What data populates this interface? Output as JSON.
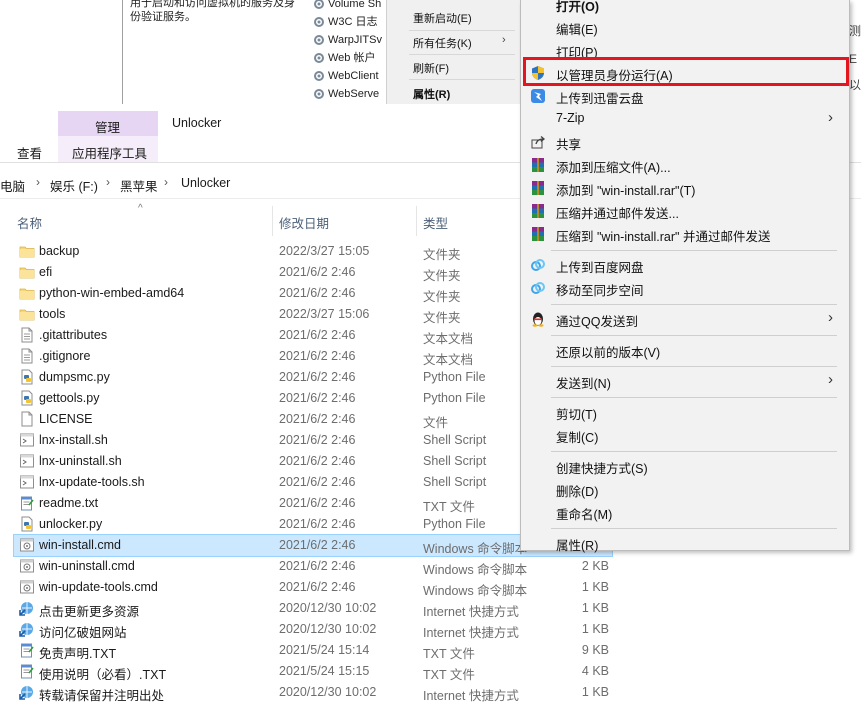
{
  "services": {
    "description": "用于启动和访问虚拟机的服务及身份验证服务。",
    "items": [
      "Volume Sh",
      "W3C 日志",
      "WarpJITSv",
      "Web 帐户",
      "WebClient",
      "WebServe"
    ],
    "menu": {
      "restart": "重新启动(E)",
      "all_tasks": "所有任务(K)",
      "all_tasks_arrow": "›",
      "refresh": "刷新(F)",
      "properties": "属性(R)"
    },
    "right_edge": [
      "测",
      "E",
      "以"
    ]
  },
  "ribbon": {
    "tab_manage": "管理",
    "window_title": "Unlocker",
    "tab_view": "查看",
    "tab_app_tools": "应用程序工具"
  },
  "address": {
    "crumbs": [
      "电脑",
      "娱乐 (F:)",
      "黑苹果",
      "Unlocker"
    ],
    "sep": "›"
  },
  "columns": {
    "name": "名称",
    "date": "修改日期",
    "type": "类型",
    "sort_caret": "^"
  },
  "files": [
    {
      "name": "backup",
      "date": "2022/3/27 15:05",
      "type": "文件夹",
      "size": "",
      "icon": "folder-icon"
    },
    {
      "name": "efi",
      "date": "2021/6/2 2:46",
      "type": "文件夹",
      "size": "",
      "icon": "folder-icon"
    },
    {
      "name": "python-win-embed-amd64",
      "date": "2021/6/2 2:46",
      "type": "文件夹",
      "size": "",
      "icon": "folder-icon"
    },
    {
      "name": "tools",
      "date": "2022/3/27 15:06",
      "type": "文件夹",
      "size": "",
      "icon": "folder-icon"
    },
    {
      "name": ".gitattributes",
      "date": "2021/6/2 2:46",
      "type": "文本文档",
      "size": "",
      "icon": "text-file-icon"
    },
    {
      "name": ".gitignore",
      "date": "2021/6/2 2:46",
      "type": "文本文档",
      "size": "",
      "icon": "text-file-icon"
    },
    {
      "name": "dumpsmc.py",
      "date": "2021/6/2 2:46",
      "type": "Python File",
      "size": "",
      "icon": "python-file-icon"
    },
    {
      "name": "gettools.py",
      "date": "2021/6/2 2:46",
      "type": "Python File",
      "size": "",
      "icon": "python-file-icon"
    },
    {
      "name": "LICENSE",
      "date": "2021/6/2 2:46",
      "type": "文件",
      "size": "",
      "icon": "blank-file-icon"
    },
    {
      "name": "lnx-install.sh",
      "date": "2021/6/2 2:46",
      "type": "Shell Script",
      "size": "",
      "icon": "script-file-icon"
    },
    {
      "name": "lnx-uninstall.sh",
      "date": "2021/6/2 2:46",
      "type": "Shell Script",
      "size": "",
      "icon": "script-file-icon"
    },
    {
      "name": "lnx-update-tools.sh",
      "date": "2021/6/2 2:46",
      "type": "Shell Script",
      "size": "",
      "icon": "script-file-icon"
    },
    {
      "name": "readme.txt",
      "date": "2021/6/2 2:46",
      "type": "TXT 文件",
      "size": "",
      "icon": "notepad-file-icon"
    },
    {
      "name": "unlocker.py",
      "date": "2021/6/2 2:46",
      "type": "Python File",
      "size": "",
      "icon": "python-file-icon"
    },
    {
      "name": "win-install.cmd",
      "date": "2021/6/2 2:46",
      "type": "Windows 命令脚本",
      "size": "",
      "icon": "cmd-file-icon",
      "selected": true
    },
    {
      "name": "win-uninstall.cmd",
      "date": "2021/6/2 2:46",
      "type": "Windows 命令脚本",
      "size": "2 KB",
      "icon": "cmd-file-icon"
    },
    {
      "name": "win-update-tools.cmd",
      "date": "2021/6/2 2:46",
      "type": "Windows 命令脚本",
      "size": "1 KB",
      "icon": "cmd-file-icon"
    },
    {
      "name": "点击更新更多资源",
      "date": "2020/12/30 10:02",
      "type": "Internet 快捷方式",
      "size": "1 KB",
      "icon": "internet-shortcut-icon"
    },
    {
      "name": "访问亿破姐网站",
      "date": "2020/12/30 10:02",
      "type": "Internet 快捷方式",
      "size": "1 KB",
      "icon": "internet-shortcut-icon"
    },
    {
      "name": "免责声明.TXT",
      "date": "2021/5/24 15:14",
      "type": "TXT 文件",
      "size": "9 KB",
      "icon": "notepad-file-icon"
    },
    {
      "name": "使用说明（必看）.TXT",
      "date": "2021/5/24 15:15",
      "type": "TXT 文件",
      "size": "4 KB",
      "icon": "notepad-file-icon"
    },
    {
      "name": "转载请保留并注明出处",
      "date": "2020/12/30 10:02",
      "type": "Internet 快捷方式",
      "size": "1 KB",
      "icon": "internet-shortcut-icon"
    }
  ],
  "context_menu": {
    "items": [
      {
        "label": "打开(O)",
        "bold": true,
        "icon": "",
        "submenu": false
      },
      {
        "label": "编辑(E)",
        "bold": false,
        "icon": "",
        "submenu": false
      },
      {
        "label": "打印(P)",
        "bold": false,
        "icon": "",
        "submenu": false
      },
      {
        "label": "以管理员身份运行(A)",
        "bold": false,
        "icon": "uac-shield-icon",
        "submenu": false,
        "highlighted": true
      },
      {
        "label": "上传到迅雷云盘",
        "bold": false,
        "icon": "thunder-cloud-icon",
        "submenu": false
      },
      {
        "label": "7-Zip",
        "bold": false,
        "icon": "",
        "submenu": true
      },
      {
        "label": "共享",
        "bold": false,
        "icon": "share-icon",
        "submenu": false
      },
      {
        "label": "添加到压缩文件(A)...",
        "bold": false,
        "icon": "winrar-icon",
        "submenu": false
      },
      {
        "label": "添加到 \"win-install.rar\"(T)",
        "bold": false,
        "icon": "winrar-icon",
        "submenu": false
      },
      {
        "label": "压缩并通过邮件发送...",
        "bold": false,
        "icon": "winrar-icon",
        "submenu": false
      },
      {
        "label": "压缩到 \"win-install.rar\" 并通过邮件发送",
        "bold": false,
        "icon": "winrar-icon",
        "submenu": false
      },
      {
        "separator": true
      },
      {
        "label": "上传到百度网盘",
        "bold": false,
        "icon": "baidu-netdisk-icon",
        "submenu": false
      },
      {
        "label": "移动至同步空间",
        "bold": false,
        "icon": "baidu-netdisk-icon",
        "submenu": false
      },
      {
        "separator": true
      },
      {
        "label": "通过QQ发送到",
        "bold": false,
        "icon": "qq-penguin-icon",
        "submenu": true
      },
      {
        "separator": true
      },
      {
        "label": "还原以前的版本(V)",
        "bold": false,
        "icon": "",
        "submenu": false
      },
      {
        "separator": true
      },
      {
        "label": "发送到(N)",
        "bold": false,
        "icon": "",
        "submenu": true
      },
      {
        "separator": true
      },
      {
        "label": "剪切(T)",
        "bold": false,
        "icon": "",
        "submenu": false
      },
      {
        "label": "复制(C)",
        "bold": false,
        "icon": "",
        "submenu": false
      },
      {
        "separator": true
      },
      {
        "label": "创建快捷方式(S)",
        "bold": false,
        "icon": "",
        "submenu": false
      },
      {
        "label": "删除(D)",
        "bold": false,
        "icon": "",
        "submenu": false
      },
      {
        "label": "重命名(M)",
        "bold": false,
        "icon": "",
        "submenu": false
      },
      {
        "separator": true
      },
      {
        "label": "属性(R)",
        "bold": false,
        "icon": "",
        "submenu": false
      }
    ],
    "submenu_arrow": "›"
  },
  "colors": {
    "highlight_box": "#e3161f",
    "selection_bg": "#cce8ff",
    "ribbon_manage": "#e7d6f3"
  }
}
